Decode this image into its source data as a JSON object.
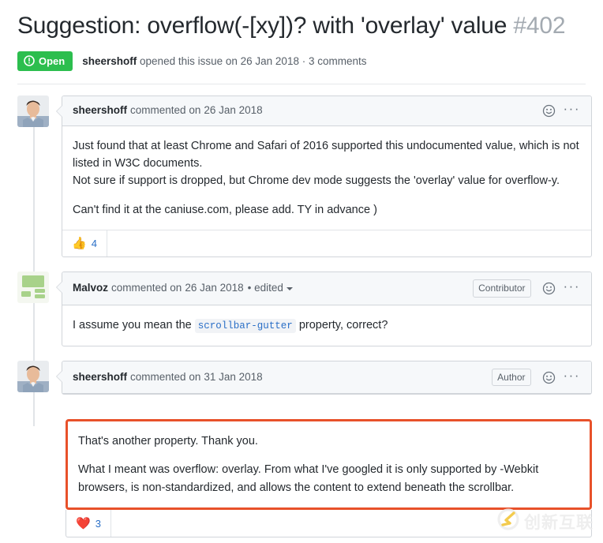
{
  "issue": {
    "title": "Suggestion: overflow(-[xy])? with 'overlay' value",
    "number": "#402",
    "state": "Open",
    "state_color": "#2cbe4e",
    "opened_by": "sheershoff",
    "opened_text_before": "opened this issue on",
    "opened_date": "26 Jan 2018",
    "separator": "·",
    "comment_count_text": "3 comments"
  },
  "icons": {
    "state": "issue-opened-icon",
    "reaction": "smiley-icon",
    "menu": "kebab-menu-icon",
    "caret": "chevron-down-icon"
  },
  "comments": [
    {
      "author": "sheershoff",
      "action": "commented on",
      "date": "26 Jan 2018",
      "edited": "",
      "role_badge": "",
      "avatar": "photo-avatar",
      "paragraphs": [
        "Just found that at least Chrome and Safari of 2016 supported this undocumented value, which is not listed in W3C documents.\nNot sure if support is dropped, but Chrome dev mode suggests the 'overlay' value for overflow-y.",
        "Can't find it at the caniuse.com, please add. TY in advance )"
      ],
      "reaction_emoji": "👍",
      "reaction_count": "4",
      "highlighted": false
    },
    {
      "author": "Malvoz",
      "action": "commented on",
      "date": "26 Jan 2018",
      "edited": "• edited",
      "role_badge": "Contributor",
      "avatar": "identicon-avatar",
      "body_prefix": "I assume you mean the",
      "body_code": "scrollbar-gutter",
      "body_suffix": "property, correct?",
      "reaction_emoji": "",
      "reaction_count": "",
      "highlighted": false
    },
    {
      "author": "sheershoff",
      "action": "commented on",
      "date": "31 Jan 2018",
      "edited": "",
      "role_badge": "Author",
      "avatar": "photo-avatar",
      "paragraphs": [
        "That's another property. Thank you.",
        "What I meant was overflow: overlay. From what I've googled it is only supported by -Webkit browsers, is non-standardized, and allows the content to extend beneath the scrollbar."
      ],
      "reaction_emoji": "❤️",
      "reaction_count": "3",
      "highlighted": true,
      "highlight_color": "#e8512a"
    }
  ],
  "watermark": {
    "text": "创新互联",
    "logo": "circle-x-logo"
  }
}
